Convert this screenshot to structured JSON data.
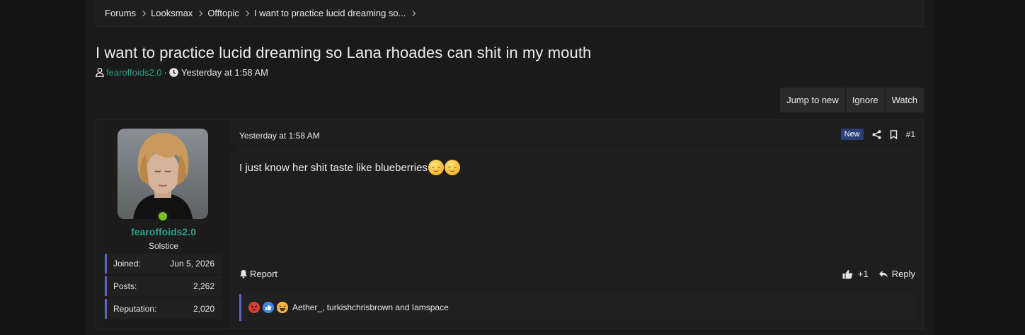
{
  "breadcrumb": [
    "Forums",
    "Looksmax",
    "Offtopic",
    "I want to practice lucid dreaming so..."
  ],
  "thread": {
    "title": "I want to practice lucid dreaming so Lana rhoades can shit in my mouth",
    "author": "fearoffoids2.0",
    "separator": "·",
    "date": "Yesterday at 1:58 AM"
  },
  "actions": {
    "jump": "Jump to new",
    "ignore": "Ignore",
    "watch": "Watch"
  },
  "user": {
    "name": "fearoffoids2.0",
    "title": "Solstice",
    "stats": [
      {
        "label": "Joined:",
        "value": "Jun 5, 2026"
      },
      {
        "label": "Posts:",
        "value": "2,262"
      },
      {
        "label": "Reputation:",
        "value": "2,020"
      }
    ]
  },
  "post": {
    "date": "Yesterday at 1:58 AM",
    "badge": "New",
    "number": "#1",
    "body": "I just know her shit taste like blueberries",
    "report": "Report",
    "like_count": "+1",
    "reply": "Reply",
    "reactions_text": "Aether_, turkishchrisbrown and Iamspace"
  },
  "colors": {
    "accent": "#2aa086",
    "stat_bar": "#5865c4",
    "online": "#7bc12a",
    "badge": "#2b3f7a"
  },
  "icons": [
    "user-icon",
    "clock-icon",
    "share-icon",
    "bookmark-icon",
    "bell-icon",
    "thumbs-up-icon",
    "reply-icon",
    "angry-reaction-icon",
    "like-reaction-icon",
    "laugh-reaction-icon"
  ]
}
